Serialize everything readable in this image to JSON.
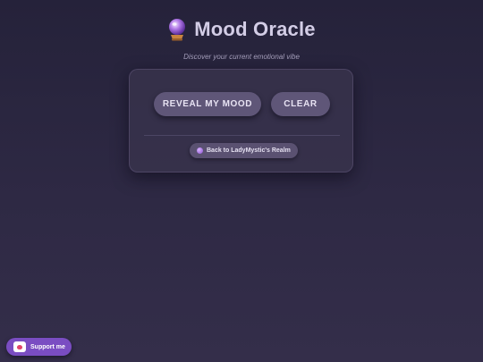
{
  "header": {
    "title": "Mood Oracle",
    "subtitle": "Discover your current emotional vibe",
    "icon": "crystal-ball-icon"
  },
  "actions": {
    "reveal_label": "REVEAL MY MOOD",
    "clear_label": "CLEAR"
  },
  "back_link": {
    "label": "Back to LadyMystic's Realm",
    "icon": "gem-icon"
  },
  "support": {
    "label": "Support me",
    "icon": "cup-icon"
  },
  "colors": {
    "background": "#2e2944",
    "button": "#5f5678",
    "support": "#7a4dc2"
  }
}
